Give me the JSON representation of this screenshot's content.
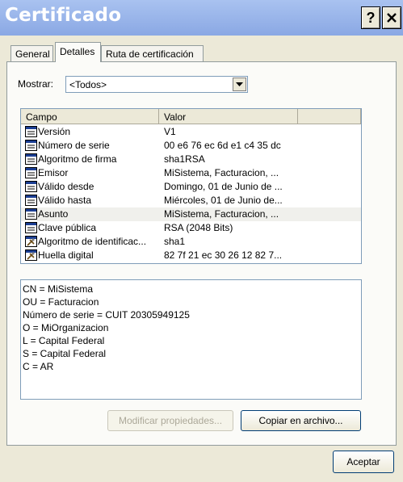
{
  "window": {
    "title": "Certificado",
    "help_label": "?"
  },
  "tabs": [
    {
      "label": "General"
    },
    {
      "label": "Detalles"
    },
    {
      "label": "Ruta de certificación"
    }
  ],
  "mostrar": {
    "label": "Mostrar:",
    "value": "<Todos>"
  },
  "fields_list": {
    "headers": [
      "Campo",
      "Valor"
    ],
    "rows": [
      {
        "campo": "Versión",
        "valor": "V1",
        "icon": "field-icon"
      },
      {
        "campo": "Número de serie",
        "valor": "00 e6 76 ec 6d e1 c4 35 dc",
        "icon": "field-icon"
      },
      {
        "campo": "Algoritmo de firma",
        "valor": "sha1RSA",
        "icon": "field-icon"
      },
      {
        "campo": "Emisor",
        "valor": "MiSistema, Facturacion, ...",
        "icon": "field-icon"
      },
      {
        "campo": "Válido desde",
        "valor": "Domingo, 01 de Junio de ...",
        "icon": "field-icon"
      },
      {
        "campo": "Válido hasta",
        "valor": "Miércoles, 01 de Junio de...",
        "icon": "field-icon"
      },
      {
        "campo": "Asunto",
        "valor": "MiSistema, Facturacion, ...",
        "icon": "field-icon",
        "selected": true
      },
      {
        "campo": "Clave pública",
        "valor": "RSA (2048 Bits)",
        "icon": "field-icon"
      },
      {
        "campo": "Algoritmo de identificac...",
        "valor": "sha1",
        "icon": "property-icon"
      },
      {
        "campo": "Huella digital",
        "valor": "82 7f 21 ec 30 26 12 82 7...",
        "icon": "property-icon"
      }
    ]
  },
  "details": {
    "lines": [
      "CN = MiSistema",
      "OU = Facturacion",
      "Número de serie = CUIT 20305949125",
      "O = MiOrganizacion",
      "L = Capital Federal",
      "S = Capital Federal",
      "C = AR"
    ]
  },
  "buttons": {
    "modificar": "Modificar propiedades...",
    "copiar": "Copiar en archivo...",
    "aceptar": "Aceptar"
  }
}
